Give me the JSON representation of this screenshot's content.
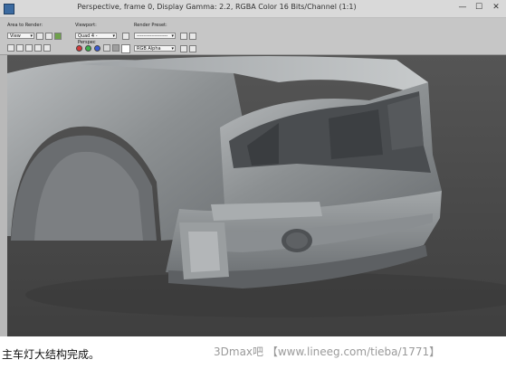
{
  "window": {
    "title": "Perspective, frame 0, Display Gamma: 2.2, RGBA Color 16 Bits/Channel (1:1)",
    "minimize_glyph": "—",
    "maximize_glyph": "☐",
    "close_glyph": "✕"
  },
  "toolbar": {
    "area_label": "Area to Render:",
    "area_value": "View",
    "viewport_label": "Viewport:",
    "viewport_value": "Quad 4 - Perspec",
    "preset_label": "Render Preset:",
    "preset_value": "-------------------",
    "channel_value": "RGB Alpha"
  },
  "caption": "主车灯大结构完成。",
  "watermark": "3Dmax吧 【www.lineeg.com/tieba/1771】"
}
